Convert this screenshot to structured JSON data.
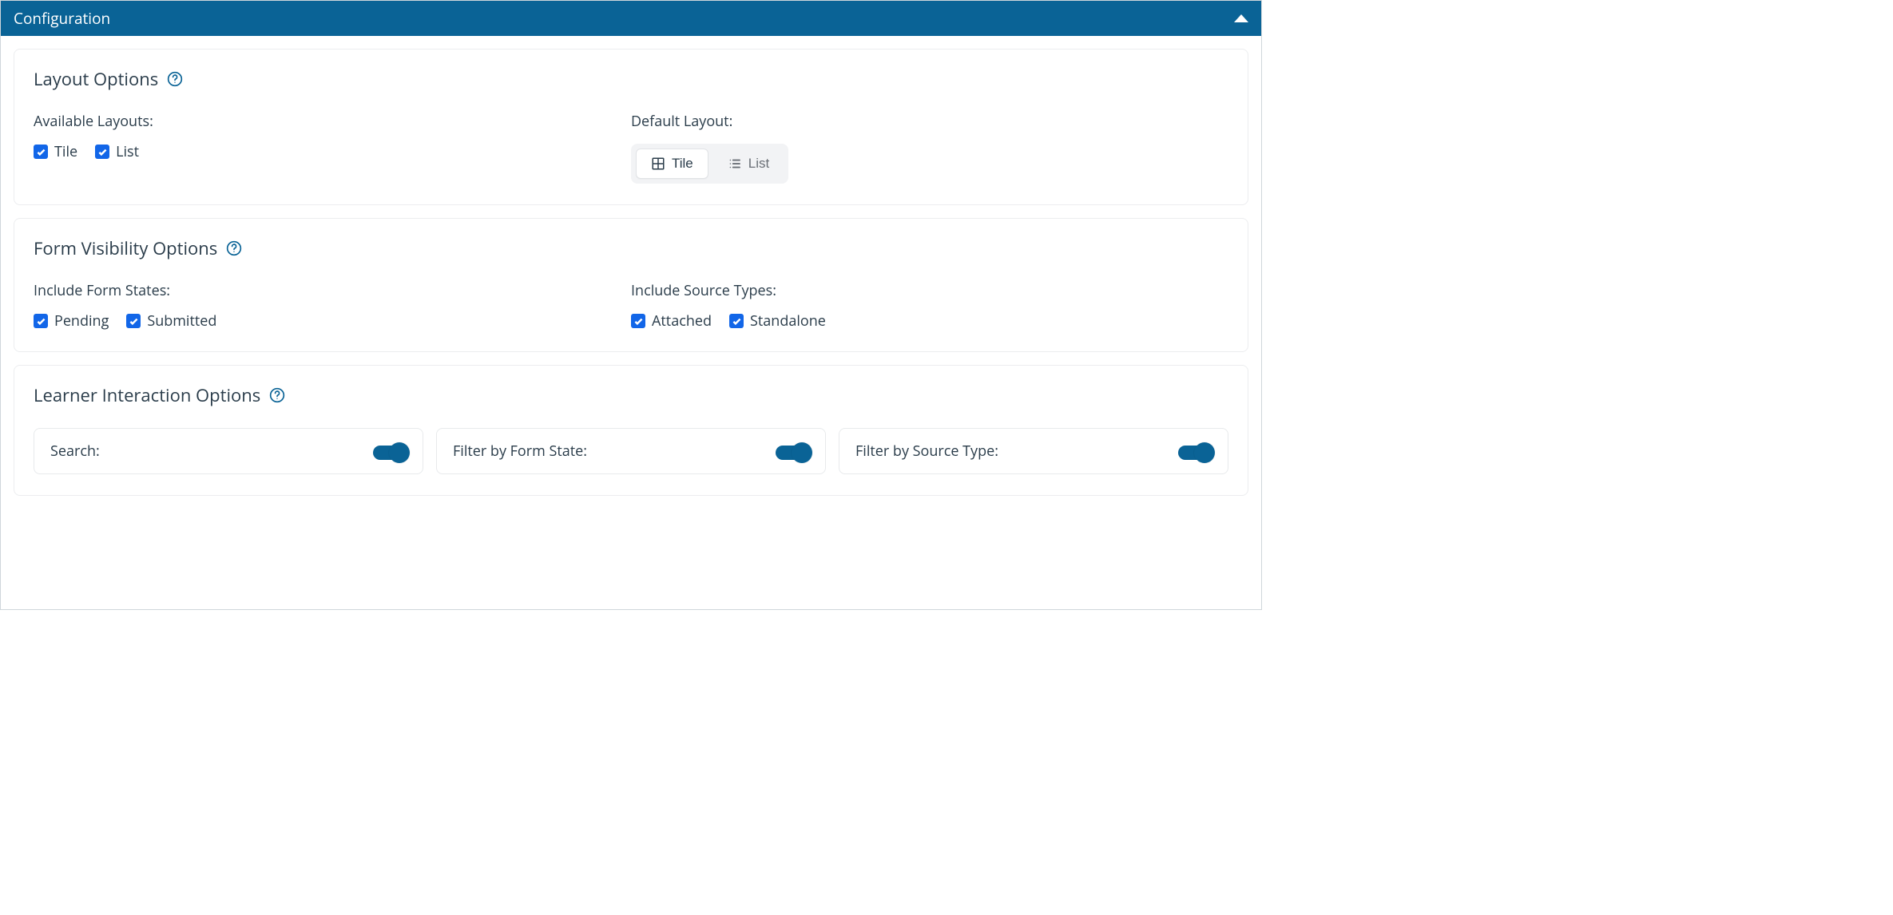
{
  "header": {
    "title": "Configuration"
  },
  "layoutOptions": {
    "title": "Layout Options",
    "availableLabel": "Available Layouts:",
    "defaultLabel": "Default Layout:",
    "checkboxes": {
      "tile": "Tile",
      "list": "List"
    },
    "segments": {
      "tile": "Tile",
      "list": "List"
    }
  },
  "formVisibility": {
    "title": "Form Visibility Options",
    "statesLabel": "Include Form States:",
    "sourceLabel": "Include Source Types:",
    "states": {
      "pending": "Pending",
      "submitted": "Submitted"
    },
    "sources": {
      "attached": "Attached",
      "standalone": "Standalone"
    }
  },
  "learnerInteraction": {
    "title": "Learner Interaction Options",
    "toggles": {
      "search": "Search:",
      "filterState": "Filter by Form State:",
      "filterSource": "Filter by Source Type:"
    }
  }
}
